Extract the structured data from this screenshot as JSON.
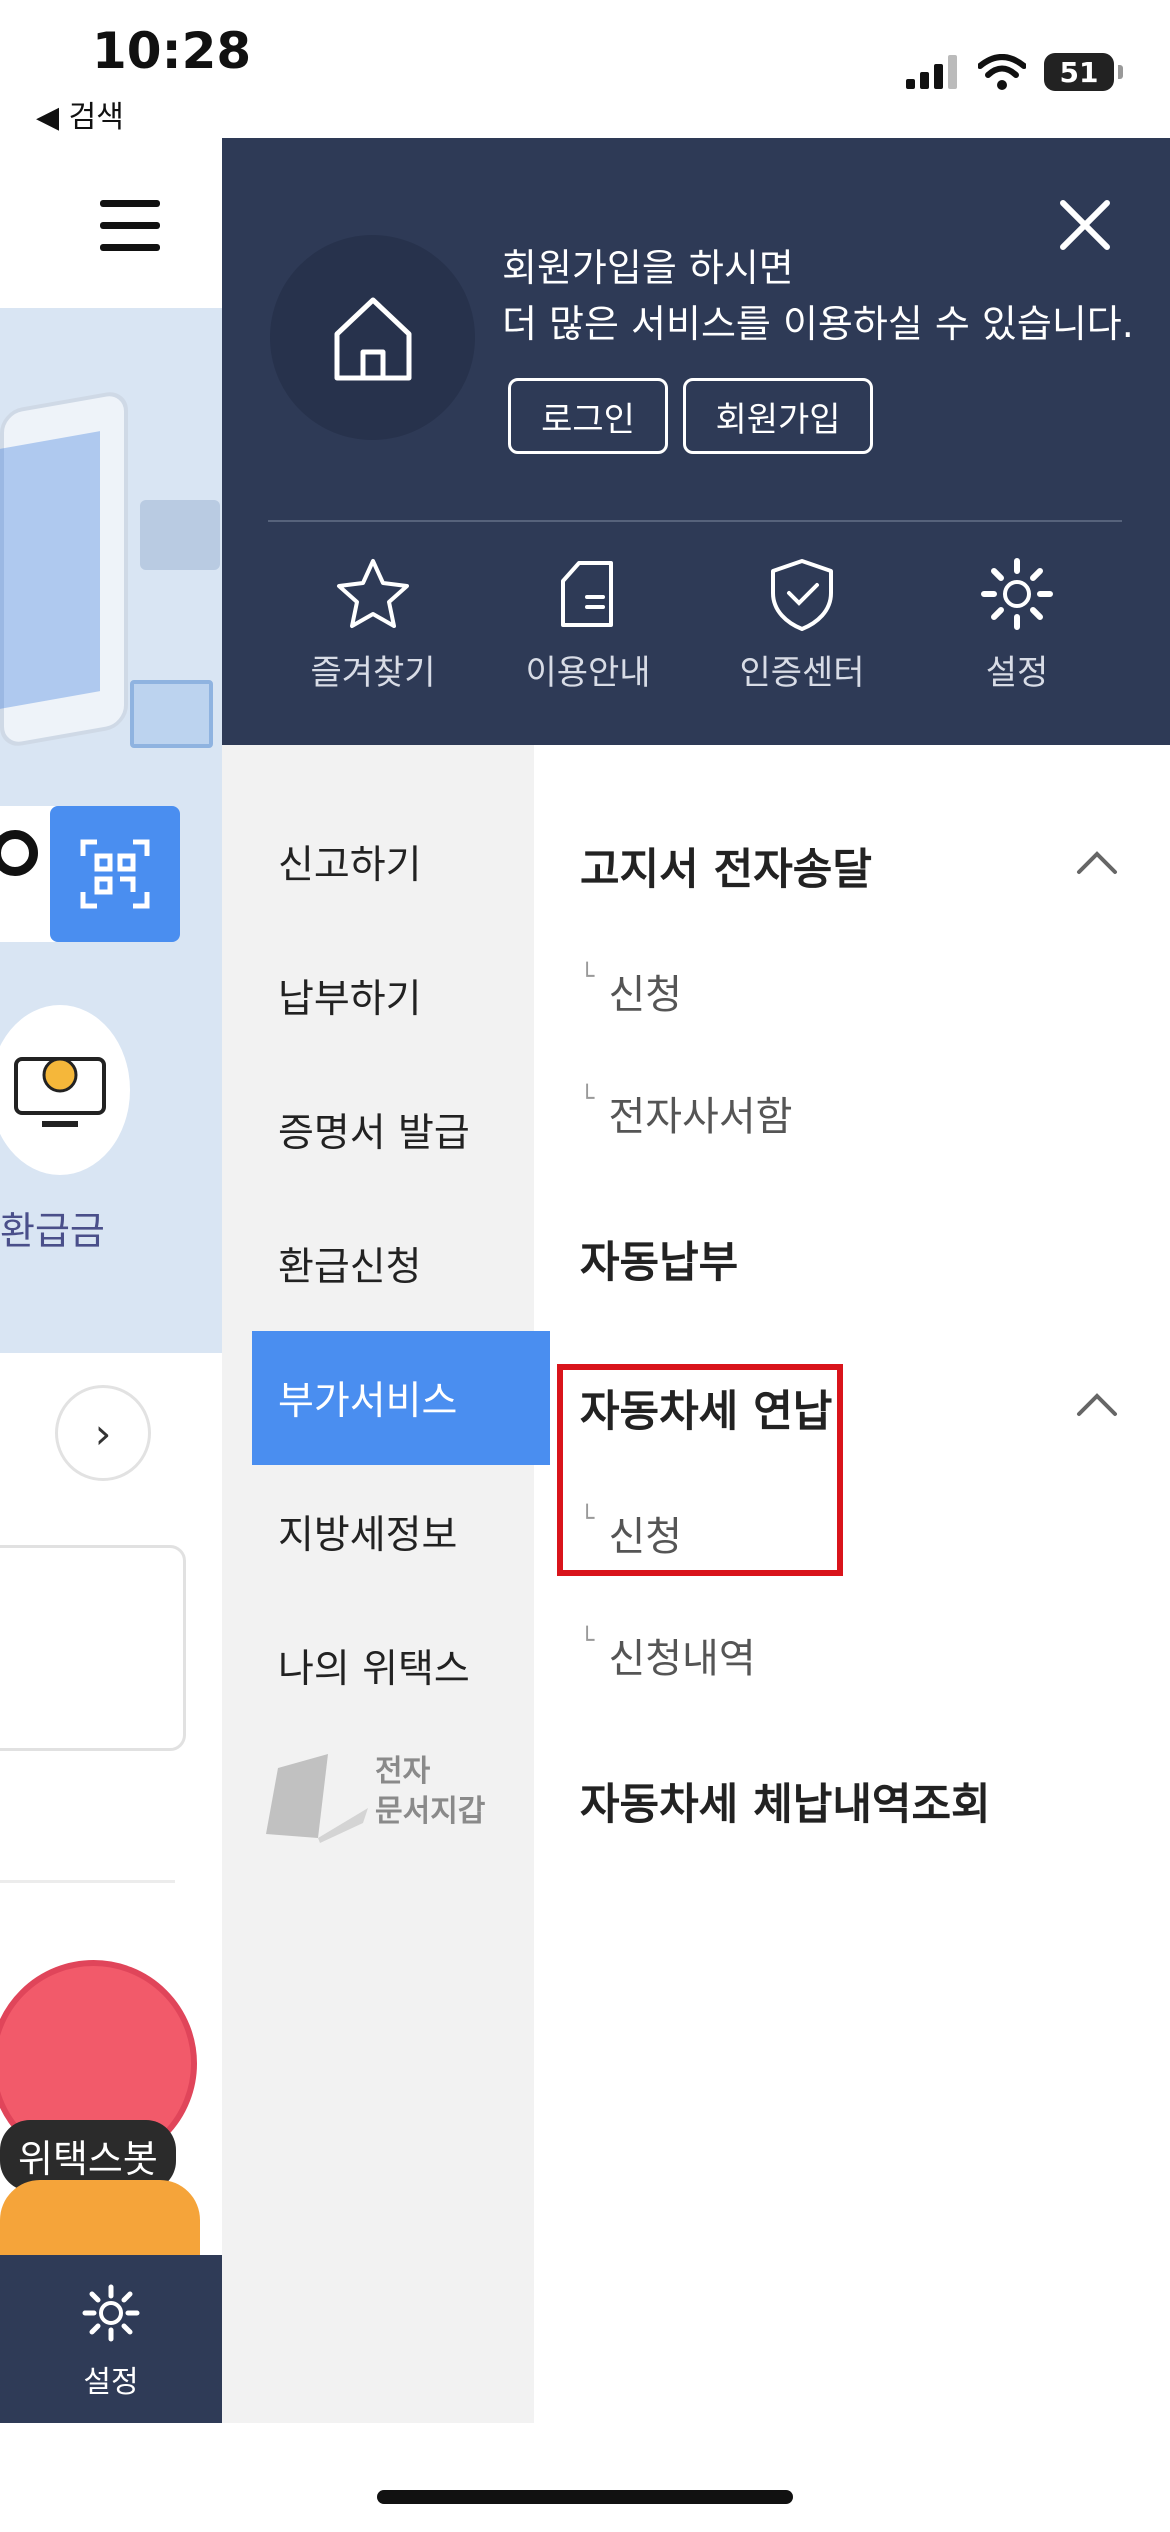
{
  "status_bar": {
    "time": "10:28",
    "back_label": "◀ 검색",
    "battery": "51"
  },
  "background_page": {
    "refund_label": "환급금",
    "bot_label": "위택스봇",
    "bottom_settings_label": "설정"
  },
  "drawer": {
    "join_message_line1": "회원가입을 하시면",
    "join_message_line2": "더 많은 서비스를 이용하실 수 있습니다.",
    "login_label": "로그인",
    "signup_label": "회원가입",
    "quick_links": [
      "즐겨찾기",
      "이용안내",
      "인증센터",
      "설정"
    ],
    "categories": [
      "신고하기",
      "납부하기",
      "증명서 발급",
      "환급신청",
      "부가서비스",
      "지방세정보",
      "나의 위택스"
    ],
    "active_category": "부가서비스",
    "wallet_line1": "전자",
    "wallet_line2": "문서지갑",
    "sections": [
      {
        "title": "고지서 전자송달",
        "items": [
          "신청",
          "전자사서함"
        ]
      },
      {
        "title": "자동납부"
      },
      {
        "title": "자동차세 연납",
        "items": [
          "신청",
          "신청내역"
        ]
      },
      {
        "title": "자동차세 체납내역조회"
      }
    ],
    "highlight_color": "#d9141b"
  },
  "colors": {
    "drawer_dark": "#2e3a56",
    "accent_blue": "#4a8ef0"
  }
}
